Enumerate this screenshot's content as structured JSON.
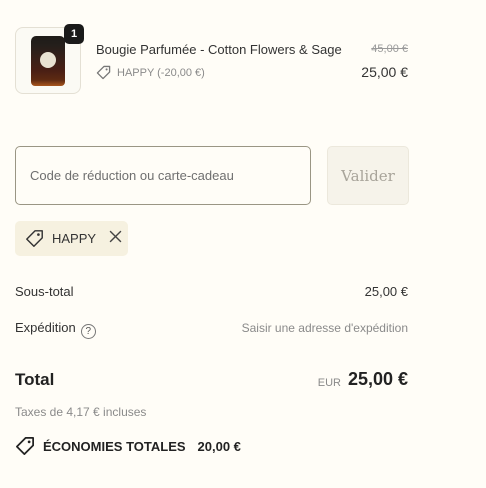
{
  "product": {
    "quantity": "1",
    "name": "Bougie Parfumée - Cotton Flowers & Sage",
    "discount_label": "HAPPY (-20,00 €)",
    "original_price": "45,00 €",
    "price": "25,00 €"
  },
  "discount_form": {
    "placeholder": "Code de réduction ou carte-cadeau",
    "apply_label": "Valider"
  },
  "applied_code": {
    "label": "HAPPY"
  },
  "summary": {
    "subtotal_label": "Sous-total",
    "subtotal_value": "25,00 €",
    "shipping_label": "Expédition",
    "shipping_help": "?",
    "shipping_value": "Saisir une adresse d'expédition",
    "total_label": "Total",
    "currency": "EUR",
    "total_value": "25,00 €",
    "taxes_note": "Taxes de 4,17 € incluses",
    "savings_label": "ÉCONOMIES TOTALES",
    "savings_value": "20,00 €"
  },
  "icons": {
    "tag": "tag-icon",
    "close": "close-icon",
    "help": "help-icon"
  }
}
